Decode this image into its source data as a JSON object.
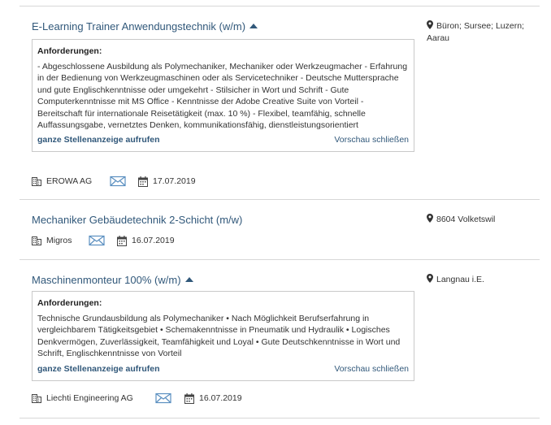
{
  "jobs": [
    {
      "title": "E-Learning Trainer Anwendungstechnik (w/m)",
      "location": "Büron; Sursee; Luzern; Aarau",
      "preview": {
        "heading": "Anforderungen:",
        "text": "- Abgeschlossene Ausbildung als Polymechaniker, Mechaniker oder Werkzeugmacher - Erfahrung in der Bedienung von Werkzeugmaschinen oder als Servicetechniker - Deutsche Muttersprache und gute Englischkenntnisse oder umgekehrt - Stilsicher in Wort und Schrift - Gute Computerkenntnisse mit MS Office - Kenntnisse der Adobe Creative Suite von Vorteil - Bereitschaft für internationale Reisetätigkeit (max. 10 %) - Flexibel, teamfähig, schnelle Auffassungsgabe, vernetztes Denken, kommunikationsfähig, dienstleistungsorientiert",
        "full_link": "ganze Stellenanzeige aufrufen",
        "close_link": "Vorschau schließen"
      },
      "company": "EROWA AG",
      "date": "17.07.2019"
    },
    {
      "title": "Mechaniker Gebäudetechnik 2-Schicht (m/w)",
      "location": "8604 Volketswil",
      "company": "Migros",
      "date": "16.07.2019"
    },
    {
      "title": "Maschinenmonteur 100% (w/m)",
      "location": "Langnau i.E.",
      "preview": {
        "heading": "Anforderungen:",
        "text": "Technische Grundausbildung als Polymechaniker • Nach Möglichkeit Berufserfahrung in vergleichbarem Tätigkeitsgebiet • Schemakenntnisse in Pneumatik und Hydraulik • Logisches Denkvermögen, Zuverlässigkeit, Teamfähigkeit und Loyal • Gute Deutschkenntnisse in Wort und Schrift, Englischkenntnisse von Vorteil",
        "full_link": "ganze Stellenanzeige aufrufen",
        "close_link": "Vorschau schließen"
      },
      "company": "Liechti Engineering AG",
      "date": "16.07.2019"
    }
  ]
}
